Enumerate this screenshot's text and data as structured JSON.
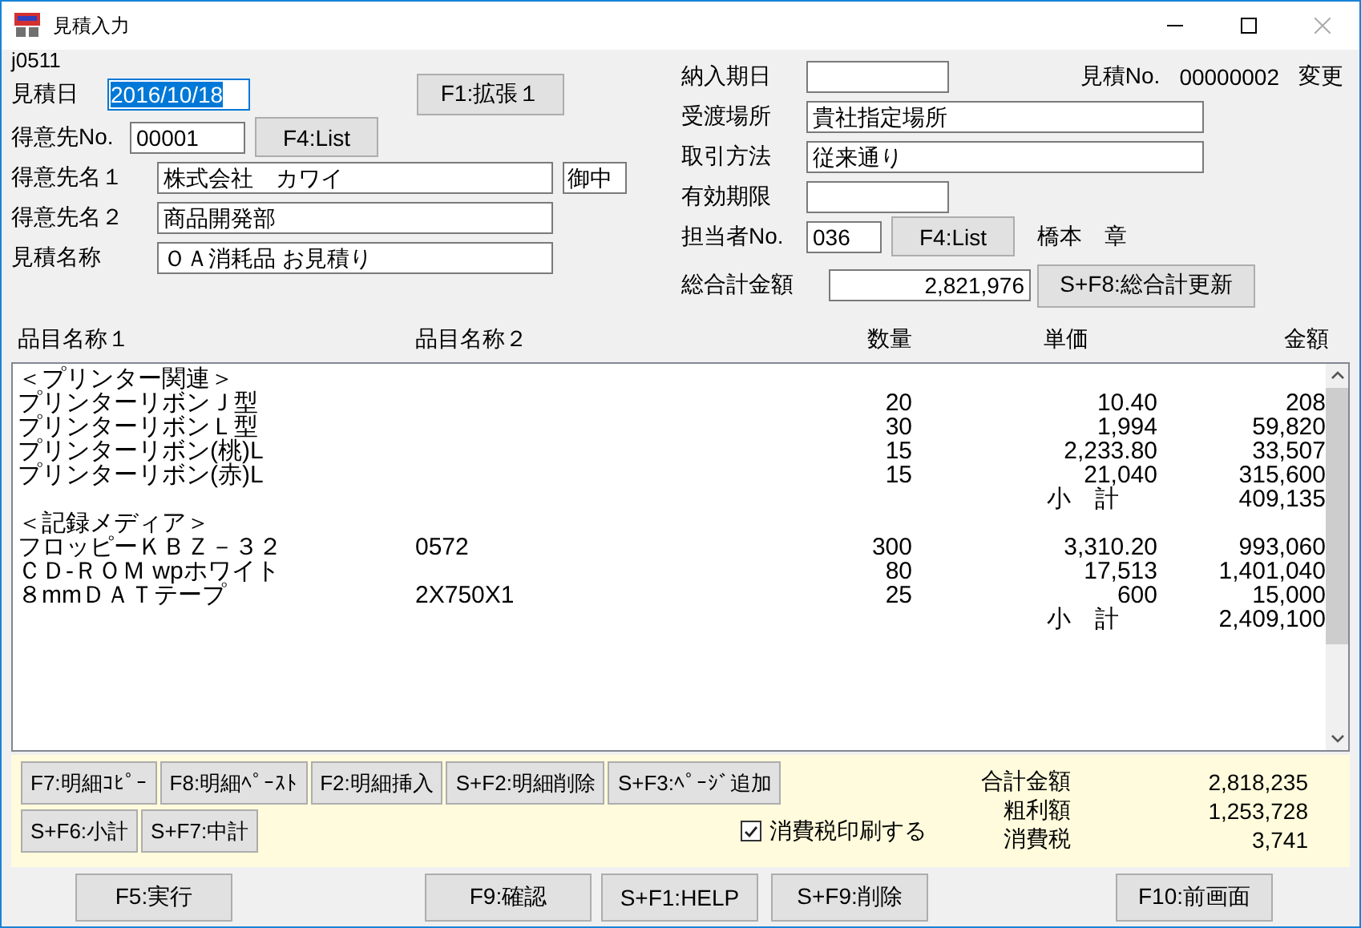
{
  "window": {
    "title": "見積入力"
  },
  "form_id": "j0511",
  "estimate_date": {
    "label": "見積日",
    "value": "2016/10/18",
    "text_selected": true
  },
  "expand_button": "F1:拡張１",
  "customer_no": {
    "label": "得意先No.",
    "value": "00001",
    "list_button": "F4:List"
  },
  "customer_name1": {
    "label": "得意先名１",
    "value": "株式会社　カワイ",
    "honorific": "御中"
  },
  "customer_name2": {
    "label": "得意先名２",
    "value": "商品開発部"
  },
  "estimate_name": {
    "label": "見積名称",
    "value": "ＯＡ消耗品 お見積り"
  },
  "delivery_date": {
    "label": "納入期日"
  },
  "estimate_no": {
    "label": "見積No.",
    "value": "00000002",
    "mode": "変更"
  },
  "delivery_place": {
    "label": "受渡場所",
    "value": "貴社指定場所"
  },
  "payment_method": {
    "label": "取引方法",
    "value": "従来通り"
  },
  "valid_until": {
    "label": "有効期限"
  },
  "staff": {
    "label": "担当者No.",
    "value": "036",
    "list_button": "F4:List",
    "name": "橋本　章"
  },
  "grand_total": {
    "label": "総合計金額",
    "value": "2,821,976",
    "update_button": "S+F8:総合計更新"
  },
  "table": {
    "columns": [
      "品目名称１",
      "品目名称２",
      "数量",
      "単価",
      "金額"
    ],
    "rows": [
      {
        "kind": "group",
        "text": "＜プリンター関連＞"
      },
      {
        "kind": "item",
        "name1": "プリンターリボンＪ型",
        "qty": "20",
        "price": "10.40",
        "amount": "208"
      },
      {
        "kind": "item",
        "name1": "プリンターリボンＬ型",
        "qty": "30",
        "price": "1,994",
        "amount": "59,820"
      },
      {
        "kind": "item",
        "name1": "プリンターリボン(桃)L",
        "qty": "15",
        "price": "2,233.80",
        "amount": "33,507"
      },
      {
        "kind": "item",
        "name1": "プリンターリボン(赤)L",
        "qty": "15",
        "price": "21,040",
        "amount": "315,600"
      },
      {
        "kind": "subtotal",
        "label": "小　計",
        "amount": "409,135"
      },
      {
        "kind": "group",
        "text": "＜記録メディア＞"
      },
      {
        "kind": "item",
        "name1": "フロッピーＫＢＺ－３２",
        "name2": "0572",
        "qty": "300",
        "price": "3,310.20",
        "amount": "993,060"
      },
      {
        "kind": "item",
        "name1": "ＣＤ-ＲＯＭ wpホワイト",
        "qty": "80",
        "price": "17,513",
        "amount": "1,401,040"
      },
      {
        "kind": "item",
        "name1": "８mmＤＡＴテープ",
        "name2": "2X750X1",
        "qty": "25",
        "price": "600",
        "amount": "15,000"
      },
      {
        "kind": "subtotal",
        "label": "小　計",
        "amount": "2,409,100"
      }
    ]
  },
  "detail_buttons": [
    "F7:明細ｺﾋﾟｰ",
    "F8:明細ﾍﾟｰｽﾄ",
    "F2:明細挿入",
    "S+F2:明細削除",
    "S+F3:ﾍﾟｰｼﾞ追加"
  ],
  "subtotal_buttons": [
    "S+F6:小計",
    "S+F7:中計"
  ],
  "tax_print": {
    "label": "消費税印刷する",
    "checked": true
  },
  "totals": [
    {
      "label": "合計金額",
      "value": "2,818,235"
    },
    {
      "label": "粗利額",
      "value": "1,253,728"
    },
    {
      "label": "消費税",
      "value": "3,741"
    }
  ],
  "footer_buttons": [
    "F5:実行",
    "F9:確認",
    "S+F1:HELP",
    "S+F9:削除",
    "F10:前画面"
  ]
}
